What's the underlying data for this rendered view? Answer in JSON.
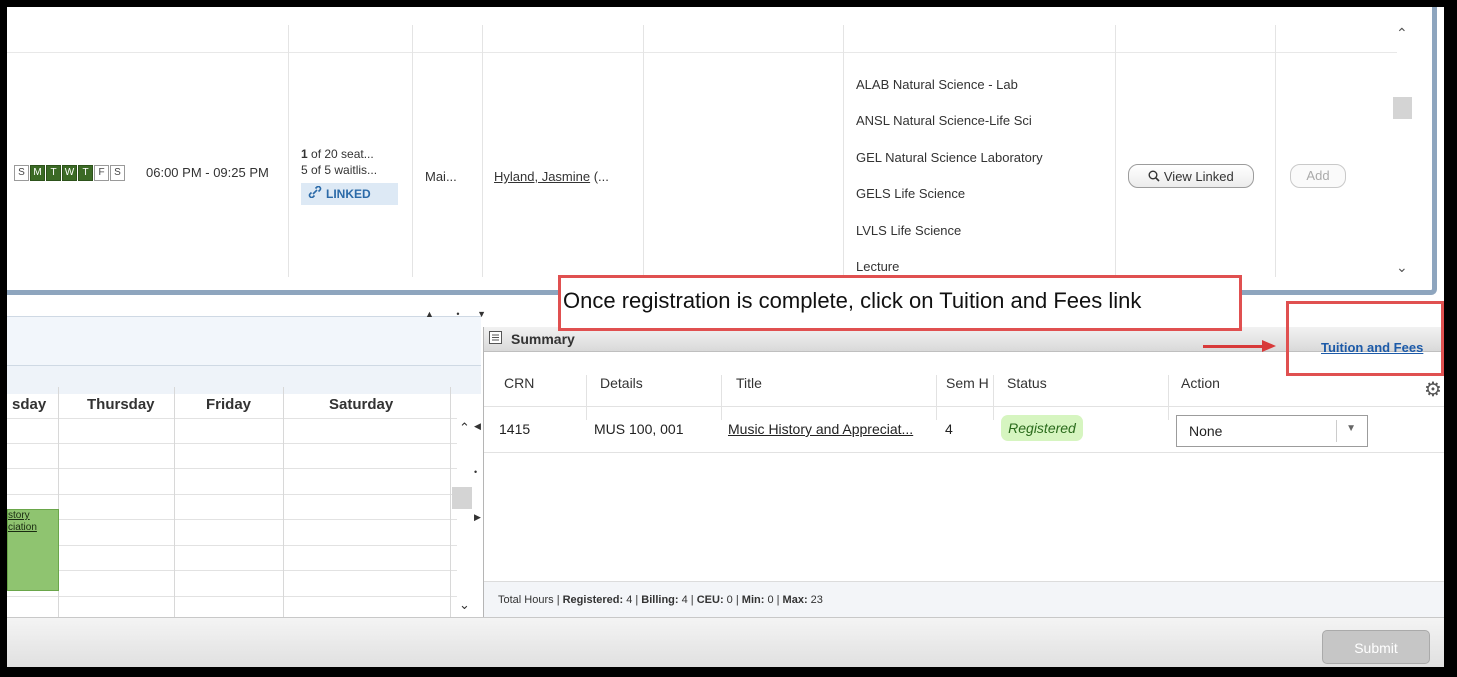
{
  "section_row": {
    "days": [
      {
        "label": "S",
        "active": false
      },
      {
        "label": "M",
        "active": true
      },
      {
        "label": "T",
        "active": true
      },
      {
        "label": "W",
        "active": true
      },
      {
        "label": "T",
        "active": true
      },
      {
        "label": "F",
        "active": false
      },
      {
        "label": "S",
        "active": false
      }
    ],
    "time": "06:00 PM - 09:25 PM",
    "seats_count": "1",
    "seats_rest": " of 20 seat...",
    "waitlist": "5 of 5 waitlis...",
    "linked_label": "LINKED",
    "campus": "Mai...",
    "instructor_name": "Hyland, Jasmine",
    "instructor_rest": " (...",
    "attributes": [
      "ALAB Natural Science - Lab",
      "ANSL Natural Science-Life Sci",
      "GEL Natural Science Laboratory",
      "GELS Life Science",
      "LVLS Life Science",
      "Lecture"
    ],
    "view_linked_label": "View Linked",
    "add_label": "Add"
  },
  "callout": {
    "text": "Once registration is complete, click on Tuition and Fees link"
  },
  "calendar": {
    "columns": [
      "sday",
      "Thursday",
      "Friday",
      "Saturday"
    ],
    "event_lines": [
      "story",
      "ciation"
    ]
  },
  "summary": {
    "title": "Summary",
    "tuition_link": "Tuition and Fees",
    "headers": {
      "crn": "CRN",
      "details": "Details",
      "title": "Title",
      "sem_hours": "Sem H",
      "status": "Status",
      "action": "Action"
    },
    "rows": [
      {
        "crn": "1415",
        "details": "MUS 100, 001",
        "title": "Music History and Appreciat...",
        "hours": "4",
        "status": "Registered",
        "action": "None"
      }
    ],
    "totals": {
      "label": "Total Hours | ",
      "registered_label": "Registered:",
      "registered": " 4 | ",
      "billing_label": "Billing:",
      "billing": " 4 | ",
      "ceu_label": "CEU:",
      "ceu": " 0 | ",
      "min_label": "Min:",
      "min": " 0 | ",
      "max_label": "Max:",
      "max": " 23"
    }
  },
  "footer": {
    "submit_label": "Submit"
  },
  "colors": {
    "day_active": "#3b6a25",
    "callout_border": "#e05050",
    "link": "#1c5aa8",
    "registered_bg": "#d6f5c0",
    "event_bg": "#8fc470"
  }
}
